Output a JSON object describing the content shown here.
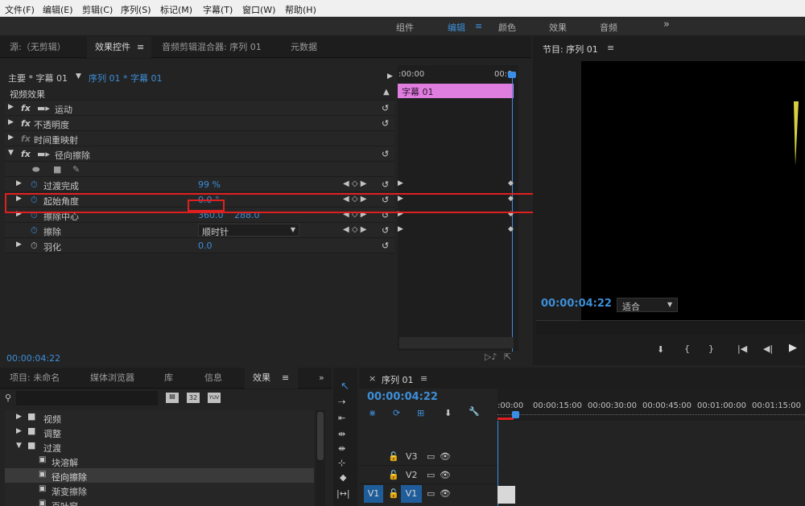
{
  "menu": [
    "文件(F)",
    "编辑(E)",
    "剪辑(C)",
    "序列(S)",
    "标记(M)",
    "字幕(T)",
    "窗口(W)",
    "帮助(H)"
  ],
  "workspaces": {
    "items": [
      "组件",
      "编辑",
      "颜色",
      "效果",
      "音频"
    ],
    "active": "编辑",
    "more": "»"
  },
  "top_tabs": {
    "source": "源:（无剪辑）",
    "effect_controls": "效果控件",
    "audio_mixer": "音频剪辑混合器: 序列 01",
    "metadata": "元数据"
  },
  "effect_controls": {
    "master": "主要 * 字幕 01",
    "sequence_clip": "序列 01 * 字幕 01",
    "section": "视频效果",
    "time_start": ":00:00",
    "time_end": "00:0",
    "clip_label": "字幕 01",
    "effects": [
      {
        "fx": "fx",
        "name": "运动"
      },
      {
        "fx": "fx",
        "name": "不透明度"
      },
      {
        "fx": "fx",
        "name": "时间重映射"
      },
      {
        "fx": "fx",
        "name": "径向擦除"
      }
    ],
    "params": [
      {
        "name": "过渡完成",
        "v1": "99 %",
        "v2": ""
      },
      {
        "name": "起始角度",
        "v1": "0.0 °",
        "v2": ""
      },
      {
        "name": "擦除中心",
        "v1": "360.0",
        "v2": "288.0"
      },
      {
        "name": "擦除",
        "v1": "顺时针",
        "v2": ""
      },
      {
        "name": "羽化",
        "v1": "0.0",
        "v2": ""
      }
    ],
    "timecode": "00:00:04:22"
  },
  "program": {
    "title": "节目: 序列 01",
    "timecode": "00:00:04:22",
    "fit": "适合"
  },
  "project_tabs": {
    "project": "项目: 未命名",
    "media_browser": "媒体浏览器",
    "library": "库",
    "info": "信息",
    "effects": "效果"
  },
  "effects_tree": {
    "items": [
      {
        "label": "视频",
        "type": "folder",
        "open": false
      },
      {
        "label": "调整",
        "type": "folder",
        "open": false
      },
      {
        "label": "过渡",
        "type": "folder",
        "open": true
      },
      {
        "label": "块溶解",
        "type": "effect"
      },
      {
        "label": "径向擦除",
        "type": "effect",
        "selected": true
      },
      {
        "label": "渐变擦除",
        "type": "effect"
      },
      {
        "label": "百叶窗",
        "type": "effect"
      }
    ],
    "badges": [
      "32",
      "YUV"
    ]
  },
  "timeline": {
    "title": "序列 01",
    "timecode": "00:00:04:22",
    "ruler": [
      ":00:00",
      "00:00:15:00",
      "00:00:30:00",
      "00:00:45:00",
      "00:01:00:00",
      "00:01:15:00"
    ],
    "tracks": [
      "V3",
      "V2",
      "V1"
    ],
    "source_patch": "V1"
  },
  "colors": {
    "accent": "#3d8fd8",
    "highlight": "#e02020",
    "clip": "#e07ee0",
    "playhead": "#3a8ee6"
  }
}
